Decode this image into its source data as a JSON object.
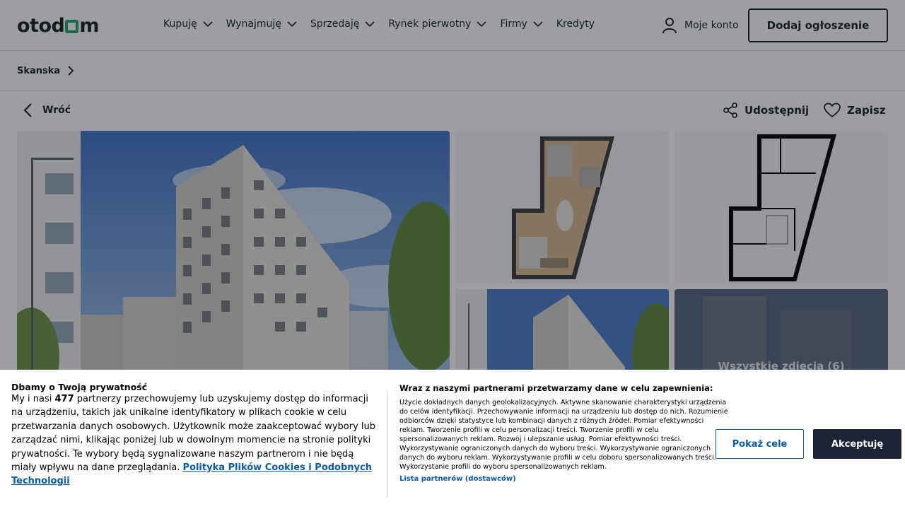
{
  "header": {
    "logo_text_left": "otod",
    "logo_text_right": "m",
    "nav": [
      {
        "label": "Kupuję",
        "has_dropdown": true
      },
      {
        "label": "Wynajmuję",
        "has_dropdown": true
      },
      {
        "label": "Sprzedaję",
        "has_dropdown": true
      },
      {
        "label": "Rynek pierwotny",
        "has_dropdown": true
      },
      {
        "label": "Firmy",
        "has_dropdown": true
      },
      {
        "label": "Kredyty",
        "has_dropdown": false
      }
    ],
    "account_label": "Moje konto",
    "add_listing_label": "Dodaj ogłoszenie"
  },
  "breadcrumb": {
    "item": "Skanska"
  },
  "actions": {
    "back_label": "Wróć",
    "share_label": "Udostępnij",
    "save_label": "Zapisz"
  },
  "gallery": {
    "all_photos_label": "Wszystkie zdjęcia (6)"
  },
  "cookie": {
    "title": "Dbamy o Twoją prywatność",
    "body_prefix": "My i nasi ",
    "partner_count": "477",
    "body_suffix": " partnerzy przechowujemy lub uzyskujemy dostęp do informacji na urządzeniu, takich jak unikalne identyfikatory w plikach cookie w celu przetwarzania danych osobowych. Użytkownik może zaakceptować wybory lub zarządzać nimi, klikając poniżej lub w dowolnym momencie na stronie polityki prywatności. Te wybory będą sygnalizowane naszym partnerom i nie będą miały wpływu na dane przeglądania. ",
    "policy_link": "Polityka Plików Cookies i Podobnych Technologii",
    "right_title": "Wraz z naszymi partnerami przetwarzamy dane w celu zapewnienia:",
    "right_body": "Użycie dokładnych danych geolokalizacyjnych. Aktywne skanowanie charakterystyki urządzenia do celów identyfikacji. Przechowywanie informacji na urządzeniu lub dostęp do nich. Rozumienie odbiorców dzięki statystyce lub kombinacji danych z różnych źródeł. Pomiar efektywności reklam. Tworzenie profili w celu personalizacji treści. Tworzenie profili w celu spersonalizowanych reklam. Rozwój i ulepszanie usług. Pomiar efektywności treści. Wykorzystywanie ograniczonych danych do wyboru treści. Wykorzystywanie ograniczonych danych do wyboru reklam. Wykorzystywanie profili w celu doboru spersonalizowanych treści. Wykorzystanie profili do wyboru spersonalizowanych reklam.",
    "partners_link": "Lista partnerów (dostawców)",
    "show_purposes_label": "Pokaż cele",
    "accept_label": "Akceptuję"
  },
  "colors": {
    "brand_green": "#22a06b",
    "link_blue": "#0a5aa8",
    "accept_bg": "#1d2433"
  }
}
